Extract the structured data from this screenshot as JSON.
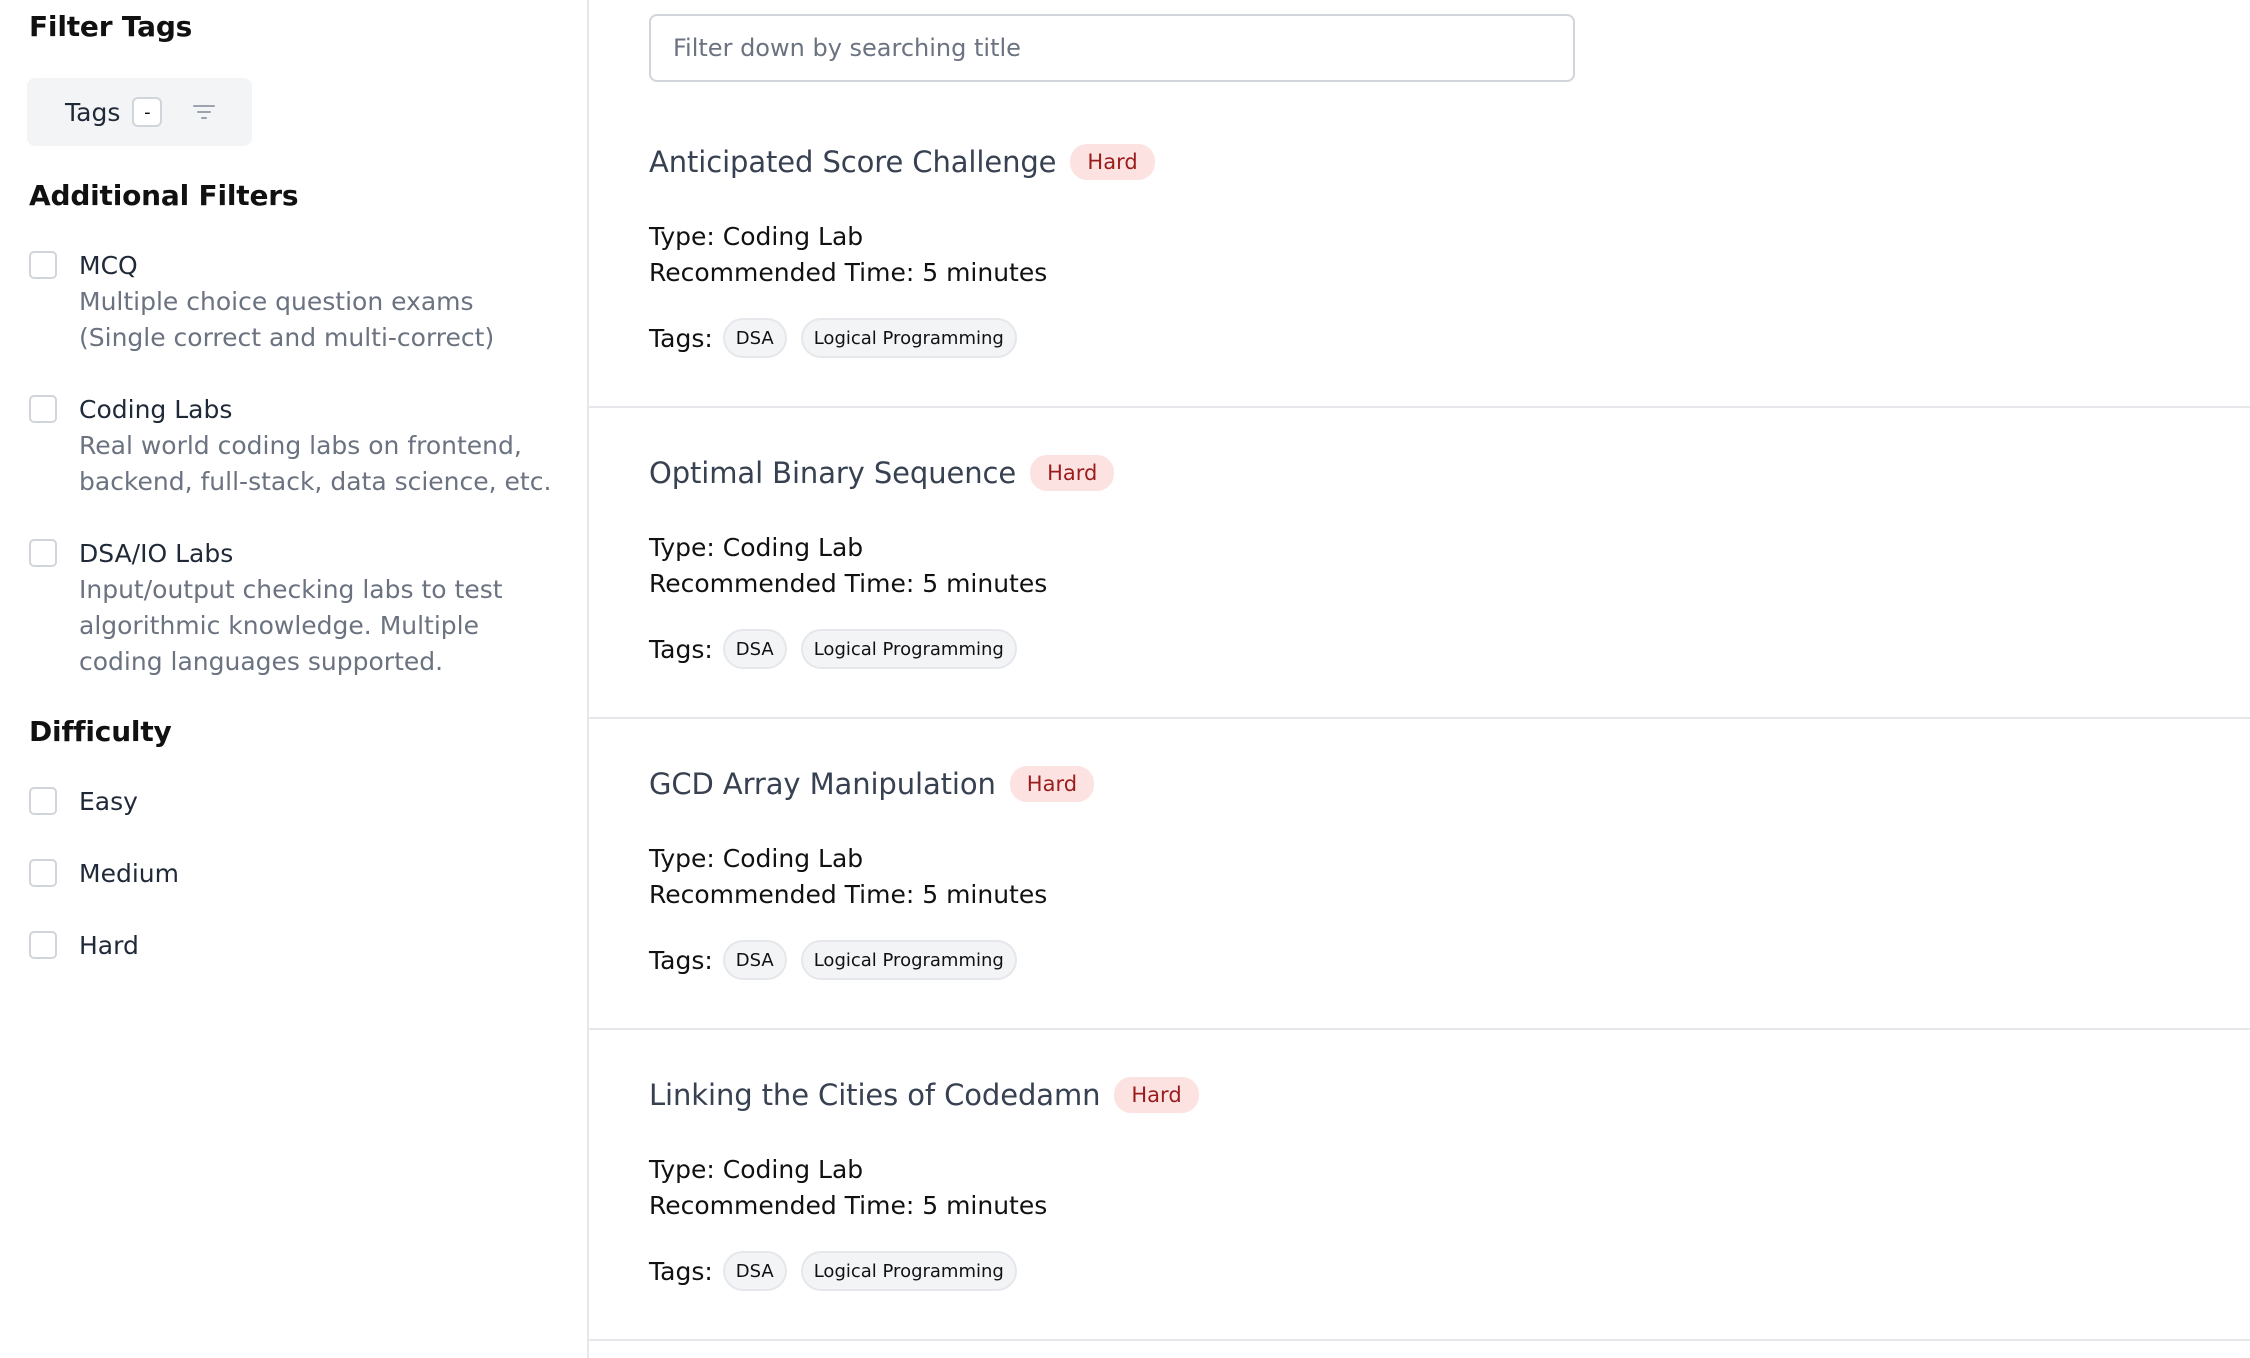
{
  "sidebar": {
    "filter_tags_heading": "Filter Tags",
    "tags_button": {
      "label": "Tags",
      "count": "-"
    },
    "additional_heading": "Additional Filters",
    "additional_filters": [
      {
        "title": "MCQ",
        "description": "Multiple choice question exams (Single correct and multi-correct)"
      },
      {
        "title": "Coding Labs",
        "description": "Real world coding labs on frontend, backend, full-stack, data science, etc."
      },
      {
        "title": "DSA/IO Labs",
        "description": "Input/output checking labs to test algorithmic knowledge. Multiple coding languages supported."
      }
    ],
    "difficulty_heading": "Difficulty",
    "difficulty_options": [
      "Easy",
      "Medium",
      "Hard"
    ]
  },
  "search": {
    "placeholder": "Filter down by searching title",
    "value": ""
  },
  "items": [
    {
      "title": "Anticipated Score Challenge",
      "difficulty": "Hard",
      "type": "Type: Coding Lab",
      "time": "Recommended Time: 5 minutes",
      "tags_label": "Tags:",
      "tags": [
        "DSA",
        "Logical Programming"
      ]
    },
    {
      "title": "Optimal Binary Sequence",
      "difficulty": "Hard",
      "type": "Type: Coding Lab",
      "time": "Recommended Time: 5 minutes",
      "tags_label": "Tags:",
      "tags": [
        "DSA",
        "Logical Programming"
      ]
    },
    {
      "title": "GCD Array Manipulation",
      "difficulty": "Hard",
      "type": "Type: Coding Lab",
      "time": "Recommended Time: 5 minutes",
      "tags_label": "Tags:",
      "tags": [
        "DSA",
        "Logical Programming"
      ]
    },
    {
      "title": "Linking the Cities of Codedamn",
      "difficulty": "Hard",
      "type": "Type: Coding Lab",
      "time": "Recommended Time: 5 minutes",
      "tags_label": "Tags:",
      "tags": [
        "DSA",
        "Logical Programming"
      ]
    }
  ],
  "icons": {
    "tags_filter": "filter-lines-icon"
  },
  "colors": {
    "badge_bg": "#fde2e2",
    "badge_text": "#9b1c1c",
    "border": "#e5e7eb"
  }
}
